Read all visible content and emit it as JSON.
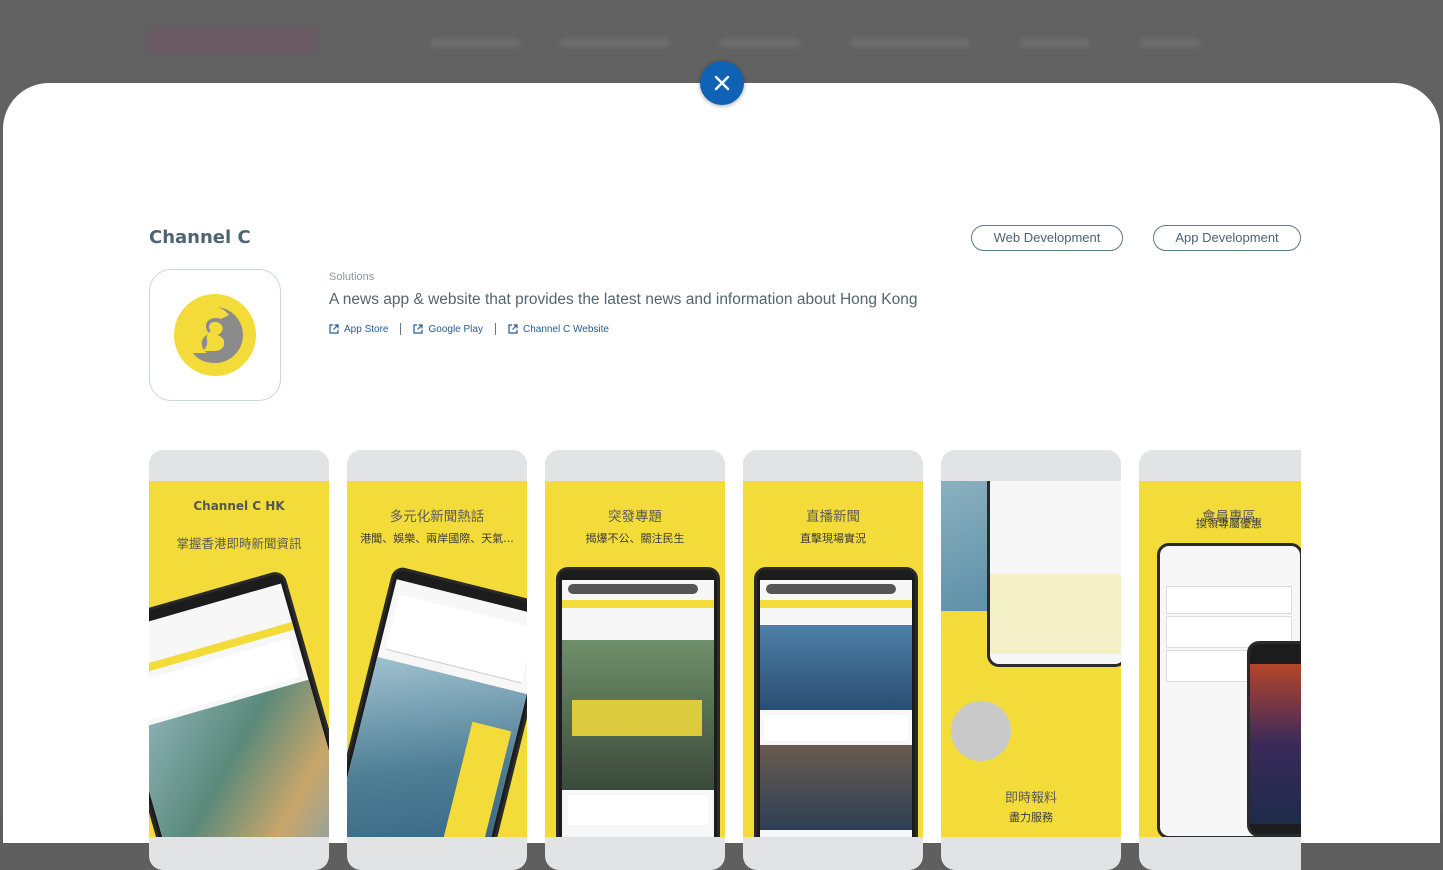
{
  "modal": {
    "close_label": "Close",
    "title": "Channel C",
    "tags": [
      "Web Development",
      "App Development"
    ],
    "solutions_label": "Solutions",
    "description": "A news app & website that provides the latest news and information about Hong Kong",
    "links": [
      {
        "label": "App Store",
        "icon": "external-link-icon"
      },
      {
        "label": "Google Play",
        "icon": "external-link-icon"
      },
      {
        "label": "Channel C Website",
        "icon": "external-link-icon"
      }
    ],
    "colors": {
      "accent": "#0f62b4",
      "brand_yellow": "#f3dc3a",
      "icon_gray": "#8b8b8b"
    }
  },
  "screenshots": [
    {
      "brand": "Channel C HK",
      "heading": "掌握香港即時新聞資訊",
      "subheading": ""
    },
    {
      "heading": "多元化新聞熱話",
      "subheading": "港聞、娛樂、兩岸國際、天氣..."
    },
    {
      "heading": "突發專題",
      "subheading": "揭爆不公、關注民生"
    },
    {
      "heading": "直播新聞",
      "subheading": "直擊現場實況"
    },
    {
      "heading": "即時報料",
      "subheading": "盡力服務"
    },
    {
      "heading": "會員專區",
      "subheading": "換領專屬優惠"
    }
  ]
}
